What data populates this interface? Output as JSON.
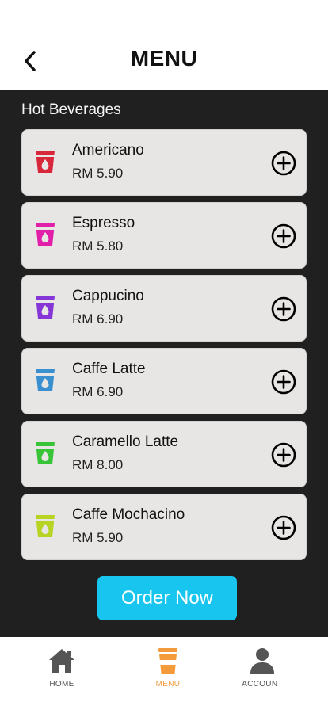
{
  "header": {
    "title": "MENU",
    "back_icon": "chevron-left-icon"
  },
  "section": {
    "title": "Hot Beverages"
  },
  "items": [
    {
      "name": "Americano",
      "price": "RM 5.90",
      "cup_color": "#d8263a"
    },
    {
      "name": "Espresso",
      "price": "RM 5.80",
      "cup_color": "#e11fa8"
    },
    {
      "name": "Cappucino",
      "price": "RM 6.90",
      "cup_color": "#8636d6"
    },
    {
      "name": "Caffe Latte",
      "price": "RM 6.90",
      "cup_color": "#3a8fd0"
    },
    {
      "name": "Caramello Latte",
      "price": "RM 8.00",
      "cup_color": "#38c437"
    },
    {
      "name": "Caffe Mochacino",
      "price": "RM 5.90",
      "cup_color": "#b7d422"
    }
  ],
  "order_button": {
    "label": "Order Now",
    "color": "#18c5ee"
  },
  "tabbar": {
    "tabs": [
      {
        "label": "HOME",
        "icon": "home-icon",
        "active": false
      },
      {
        "label": "MENU",
        "icon": "coffee-cup-icon",
        "active": true
      },
      {
        "label": "ACCOUNT",
        "icon": "user-icon",
        "active": false
      }
    ],
    "active_color": "#f39a3b",
    "inactive_color": "#555555"
  }
}
